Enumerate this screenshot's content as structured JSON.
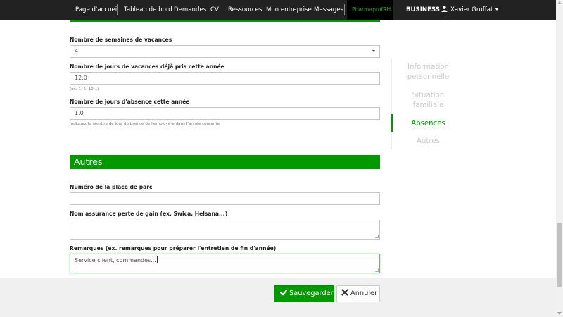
{
  "nav": {
    "items": [
      "Page d'accueil",
      "Tableau de bord",
      "Demandes",
      "CV",
      "Ressources",
      "Mon entreprise",
      "Messages"
    ],
    "brand": "PharmaprofRH",
    "business": "BUSINESS",
    "user": "Xavier Gruffat"
  },
  "form": {
    "vacation_weeks": {
      "label": "Nombre de semaines de vacances",
      "value": "4"
    },
    "vacation_taken": {
      "label": "Nombre de jours de vacances déjà pris cette année",
      "value": "12.0",
      "help": "(ex. 1, 5, 10...)"
    },
    "absence_days": {
      "label": "Nombre de jours d'absence cette année",
      "value": "1.0",
      "help": "Indiquez le nombre de jour d'absence de l'employé-e dans l'année courante"
    }
  },
  "section_autres": {
    "title": "Autres",
    "parking": {
      "label": "Numéro de la place de parc",
      "value": ""
    },
    "insurance": {
      "label": "Nom assurance perte de gain (ex. Swica, Helsana...)",
      "value": ""
    },
    "remarks": {
      "label": "Remarques (ex. remarques pour préparer l'entretien de fin d'année)",
      "value": "Service client, commandes..."
    }
  },
  "sidenav": {
    "items": [
      {
        "line1": "Information",
        "line2": "personnelle"
      },
      {
        "line1": "Situation",
        "line2": "familiale"
      },
      {
        "line1": "Absences",
        "line2": ""
      },
      {
        "line1": "Autres",
        "line2": ""
      }
    ],
    "active_index": 2
  },
  "actions": {
    "save": "Sauvegarder",
    "cancel": "Annuler"
  },
  "colors": {
    "accent": "#009900",
    "navbar": "#222222"
  }
}
